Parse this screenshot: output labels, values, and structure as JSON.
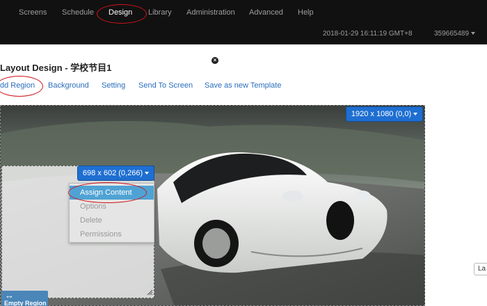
{
  "nav": {
    "items": [
      {
        "label": "Screens"
      },
      {
        "label": "Schedule"
      },
      {
        "label": "Design"
      },
      {
        "label": "Library"
      },
      {
        "label": "Administration"
      },
      {
        "label": "Advanced"
      },
      {
        "label": "Help"
      }
    ],
    "datetime": "2018-01-29 16:11:19 GMT+8",
    "user": "359665489"
  },
  "page": {
    "title": "Layout Design - 学校节目1"
  },
  "toolbar": {
    "add_region": "dd Region",
    "background": "Background",
    "setting": "Setting",
    "send_to_screen": "Send To Screen",
    "save_template": "Save as new Template"
  },
  "layout": {
    "resolution_label": "1920 x 1080 (0,0)"
  },
  "region": {
    "size_label": "698 x 602 (0,266)",
    "menu": [
      {
        "label": "Assign Content"
      },
      {
        "label": "Options"
      },
      {
        "label": "Delete"
      },
      {
        "label": "Permissions"
      }
    ],
    "tag": "Empty Region"
  },
  "side_stub": "La",
  "colors": {
    "navbar": "#111111",
    "link": "#2a6ebb",
    "primary_button": "#1e6fd2",
    "menu_active": "#4fa3d4",
    "annotation": "#d0141c"
  }
}
